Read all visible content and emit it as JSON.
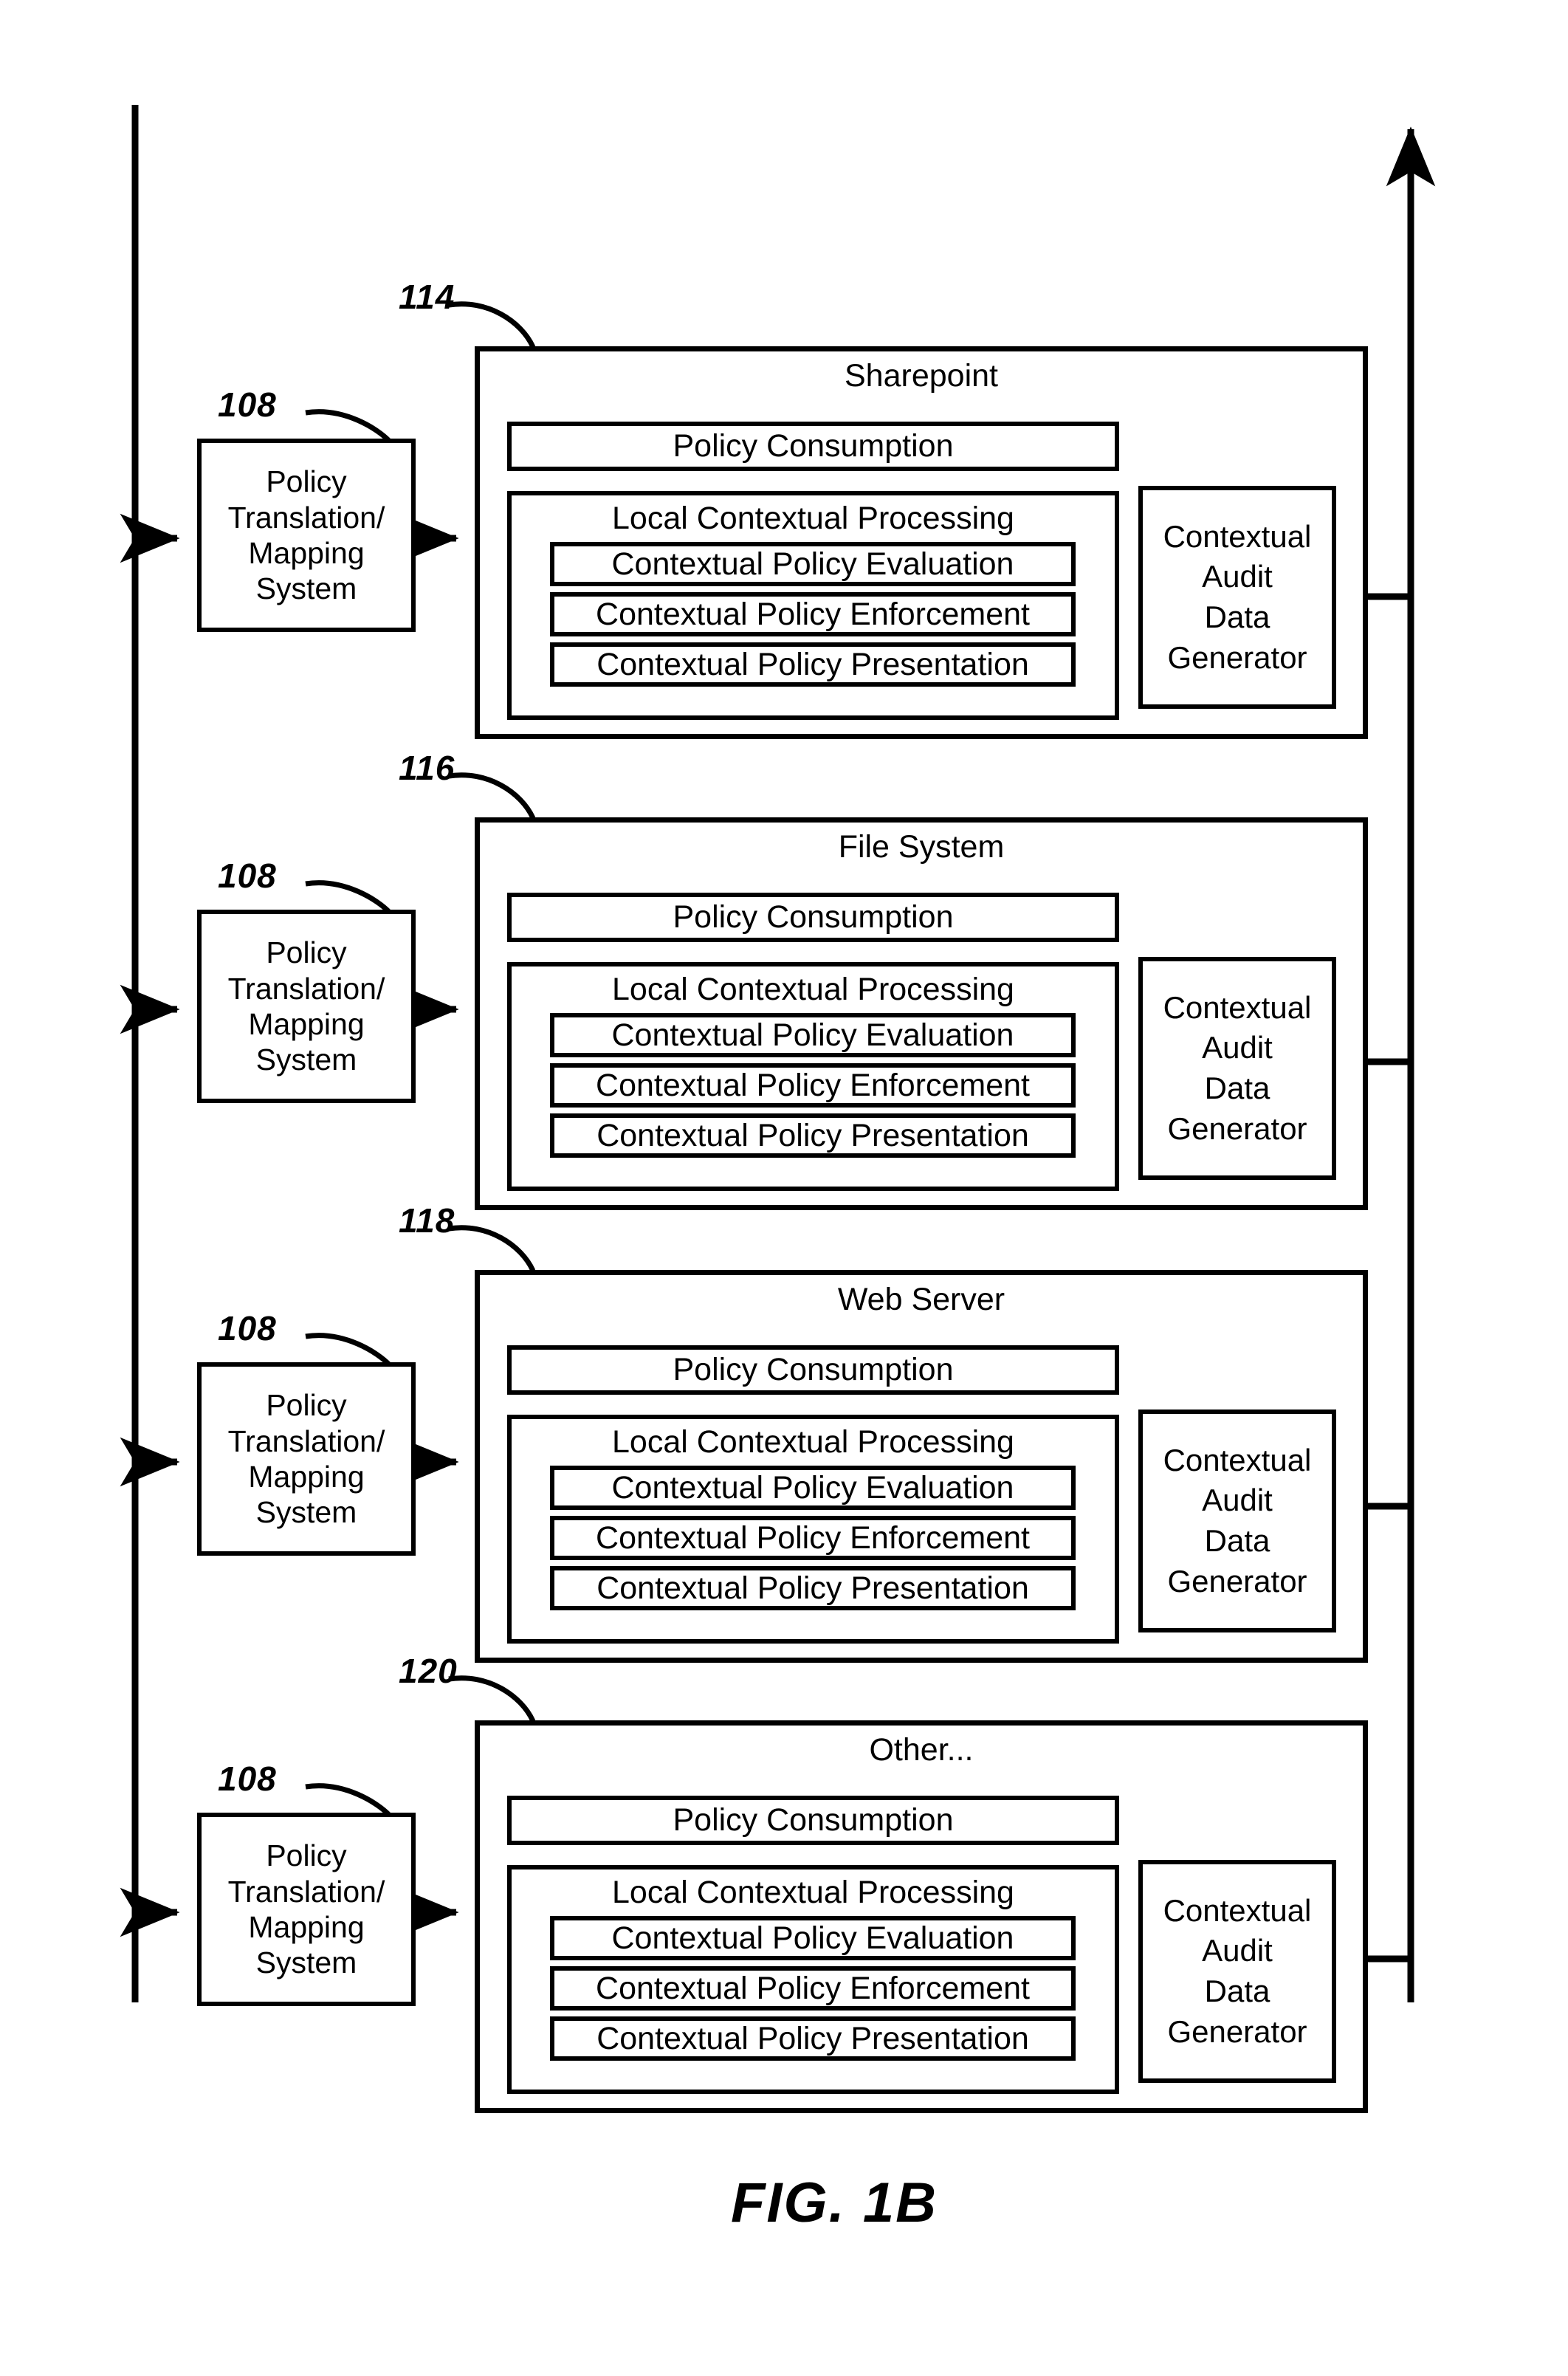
{
  "figure": {
    "label": "FIG. 1B"
  },
  "common": {
    "policy_translation_lines": [
      "Policy",
      "Translation/",
      "Mapping",
      "System"
    ],
    "policy_consumption_label": "Policy Consumption",
    "local_contextual_processing_label": "Local Contextual Processing",
    "contextual_policy_evaluation_label": "Contextual Policy Evaluation",
    "contextual_policy_enforcement_label": "Contextual Policy Enforcement",
    "contextual_policy_presentation_label": "Contextual Policy Presentation",
    "contextual_audit_data_generator_lines": [
      "Contextual",
      "Audit",
      "Data",
      "Generator"
    ],
    "policy_translation_ref": "108"
  },
  "blocks": [
    {
      "ref": "114",
      "title": "Sharepoint"
    },
    {
      "ref": "116",
      "title": "File System"
    },
    {
      "ref": "118",
      "title": "Web Server"
    },
    {
      "ref": "120",
      "title": "Other..."
    }
  ],
  "colors": {
    "stroke": "#000000",
    "background": "#ffffff"
  }
}
